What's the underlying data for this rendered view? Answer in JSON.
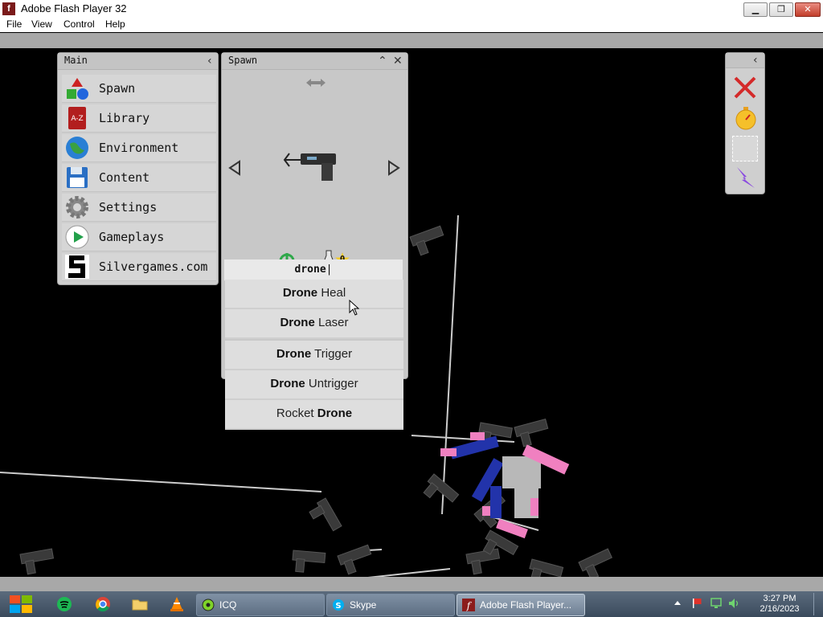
{
  "window": {
    "title": "Adobe Flash Player 32",
    "app_icon_glyph": "f",
    "buttons": [
      "minimize",
      "maximize",
      "close"
    ]
  },
  "menubar": {
    "items": [
      "File",
      "View",
      "Control",
      "Help"
    ]
  },
  "main_panel": {
    "title": "Main",
    "collapse_icon": "chevron-left-icon",
    "items": [
      {
        "label": "Spawn",
        "icon": "shapes-icon"
      },
      {
        "label": "Library",
        "icon": "book-a-z-icon"
      },
      {
        "label": "Environment",
        "icon": "globe-icon"
      },
      {
        "label": "Content",
        "icon": "floppy-disk-icon"
      },
      {
        "label": "Settings",
        "icon": "gear-icon"
      },
      {
        "label": "Gameplays",
        "icon": "play-icon"
      },
      {
        "label": "Silvergames.com",
        "icon": "silvergames-logo-icon"
      }
    ]
  },
  "spawn_panel": {
    "title": "Spawn",
    "selected_item_icon": "pistol-icon",
    "badge_count": "0",
    "search": {
      "value": "drone"
    },
    "results": [
      {
        "bold": "Drone",
        "rest": " Heal",
        "prefix": ""
      },
      {
        "bold": "Drone",
        "rest": " Laser",
        "prefix": ""
      },
      {
        "bold": "Drone",
        "rest": " Trigger",
        "prefix": ""
      },
      {
        "bold": "Drone",
        "rest": " Untrigger",
        "prefix": ""
      },
      {
        "bold": "Drone",
        "rest": "",
        "prefix": "Rocket "
      }
    ]
  },
  "toolbox": {
    "tools": [
      "delete-x-icon",
      "stopwatch-icon",
      "selection-box-icon",
      "lightning-icon"
    ]
  },
  "taskbar": {
    "items": [
      {
        "label": "ICQ",
        "icon": "icq-icon"
      },
      {
        "label": "Skype",
        "icon": "skype-icon"
      },
      {
        "label": "Adobe Flash Player...",
        "icon": "flash-icon",
        "active": true
      }
    ],
    "clock": {
      "time": "3:27 PM",
      "date": "2/16/2023"
    }
  },
  "colors": {
    "panel_bg": "#cfcfcf",
    "game_bg": "#000000",
    "taskbar": "#4a5a6c",
    "ragdoll_blue": "#2233aa",
    "ragdoll_pink": "#f080c0"
  }
}
